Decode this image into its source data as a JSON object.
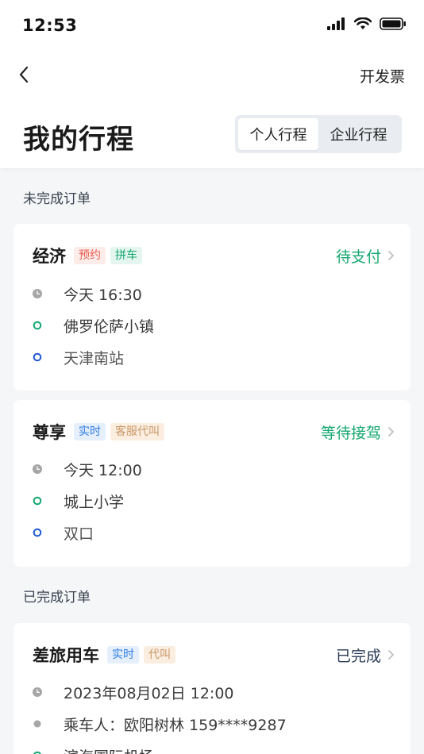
{
  "status_bar": {
    "time": "12:53"
  },
  "nav": {
    "invoice": "开发票"
  },
  "page": {
    "title": "我的行程"
  },
  "segment": {
    "personal": "个人行程",
    "business": "企业行程"
  },
  "sections": {
    "incomplete": "未完成订单",
    "completed": "已完成订单"
  },
  "orders": [
    {
      "car_type": "经济",
      "tags": [
        "预约",
        "拼车"
      ],
      "status": "待支付",
      "time": "今天 16:30",
      "from": "佛罗伦萨小镇",
      "to": "天津南站"
    },
    {
      "car_type": "尊享",
      "tags": [
        "实时",
        "客服代叫"
      ],
      "status": "等待接驾",
      "time": "今天 12:00",
      "from": "城上小学",
      "to": "双口"
    },
    {
      "car_type": "差旅用车",
      "tags": [
        "实时",
        "代叫"
      ],
      "status": "已完成",
      "time": "2023年08月02日 12:00",
      "passenger": "乘车人：欧阳树林 159****9287",
      "from": "滨海国际机场"
    }
  ],
  "colors": {
    "green": "#14a870",
    "blue": "#2f7be0",
    "red": "#e55b4d",
    "gray": "#9a9a9a"
  }
}
